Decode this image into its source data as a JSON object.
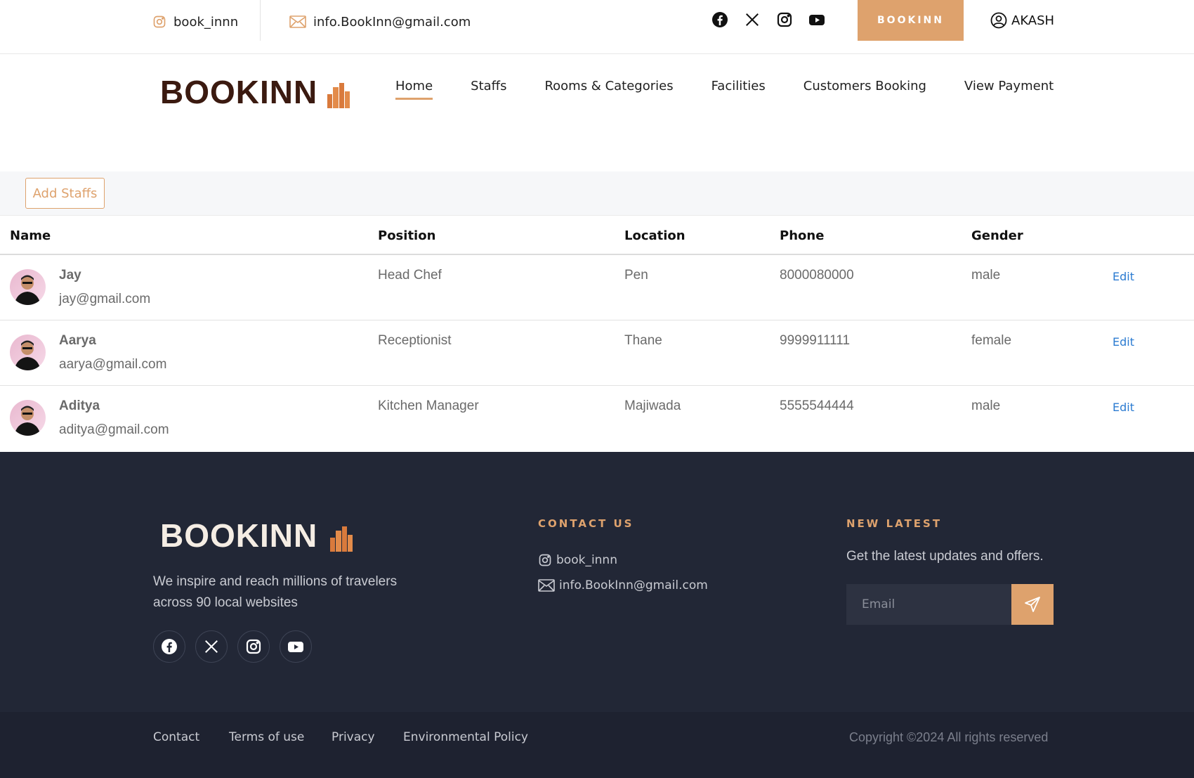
{
  "topbar": {
    "instagram_handle": "book_innn",
    "email": "info.BookInn@gmail.com",
    "social_icons": [
      "facebook-icon",
      "x-icon",
      "instagram-icon",
      "youtube-icon"
    ],
    "cta_label": "BOOKINN",
    "user_name": "AKASH"
  },
  "brand": {
    "logo_text": "BOOKINN",
    "accent_color": "#dea26d",
    "logo_color": "#3b1a10"
  },
  "nav": {
    "items": [
      {
        "label": "Home",
        "active": true
      },
      {
        "label": "Staffs"
      },
      {
        "label": "Rooms & Categories"
      },
      {
        "label": "Facilities"
      },
      {
        "label": "Customers Booking"
      },
      {
        "label": "View Payment"
      }
    ]
  },
  "staff": {
    "add_label": "Add Staffs",
    "columns": [
      "Name",
      "Position",
      "Location",
      "Phone",
      "Gender"
    ],
    "edit_label": "Edit",
    "rows": [
      {
        "name": "Jay",
        "email": "jay@gmail.com",
        "position": "Head Chef",
        "location": "Pen",
        "phone": "8000080000",
        "gender": "male"
      },
      {
        "name": "Aarya",
        "email": "aarya@gmail.com",
        "position": "Receptionist",
        "location": "Thane",
        "phone": "9999911111",
        "gender": "female"
      },
      {
        "name": "Aditya",
        "email": "aditya@gmail.com",
        "position": "Kitchen Manager",
        "location": "Majiwada",
        "phone": "5555544444",
        "gender": "male"
      }
    ]
  },
  "footer": {
    "logo_text": "BOOKINN",
    "tagline": "We inspire and reach millions of travelers across 90 local websites",
    "contact_heading": "CONTACT US",
    "contact_instagram": "book_innn",
    "contact_email": "info.BookInn@gmail.com",
    "latest_heading": "NEW LATEST",
    "latest_text": "Get the latest updates and offers.",
    "email_placeholder": "Email",
    "bottom_links": [
      "Contact",
      "Terms of use",
      "Privacy",
      "Environmental Policy"
    ],
    "copyright": "Copyright ©2024 All rights reserved"
  }
}
